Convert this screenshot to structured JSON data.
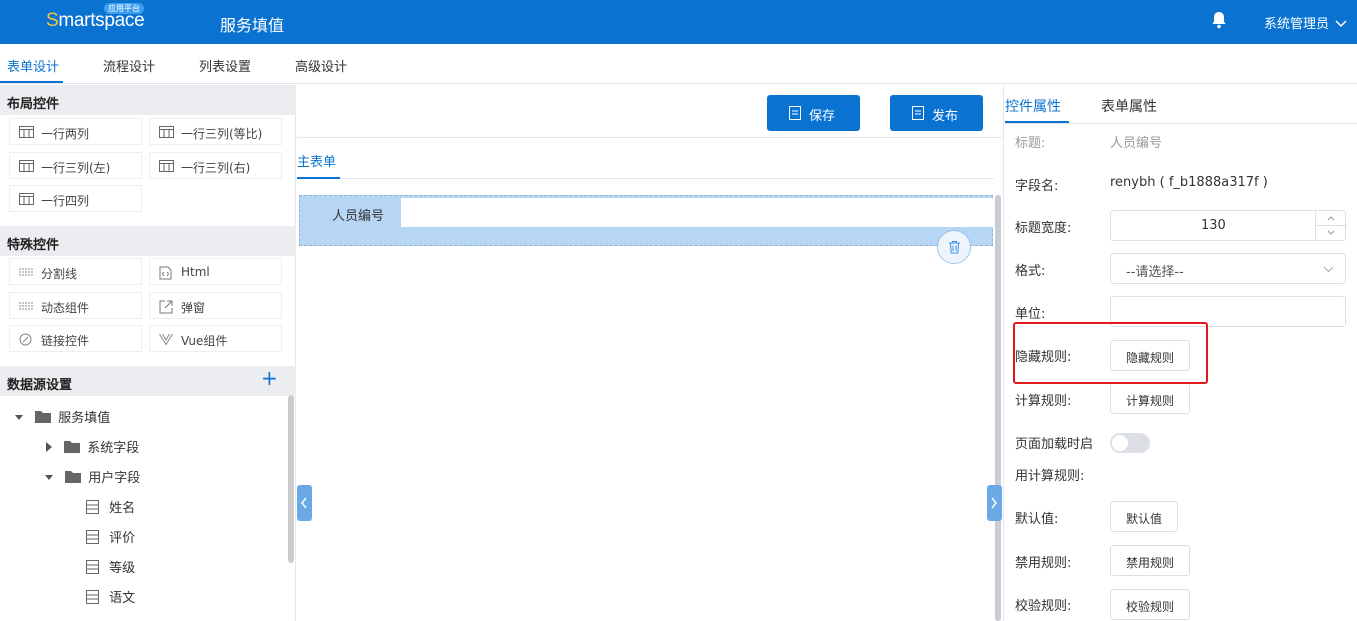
{
  "header": {
    "logo_text": "martspace",
    "logo_s": "S",
    "logo_badge": "应用平台",
    "app_title": "服务填值",
    "user_label": "系统管理员"
  },
  "tabs": [
    {
      "label": "表单设计",
      "active": true
    },
    {
      "label": "流程设计"
    },
    {
      "label": "列表设置"
    },
    {
      "label": "高级设计"
    }
  ],
  "left_panel": {
    "layout_title": "布局控件",
    "layout_controls": [
      "一行两列",
      "一行三列(等比)",
      "一行三列(左)",
      "一行三列(右)",
      "一行四列"
    ],
    "special_title": "特殊控件",
    "special_controls": [
      "分割线",
      "Html",
      "动态组件",
      "弹窗",
      "链接控件",
      "Vue组件"
    ],
    "datasource_title": "数据源设置",
    "tree": {
      "root": "服务填值",
      "system_fields": "系统字段",
      "user_fields": "用户字段",
      "user_field_items": [
        "姓名",
        "评价",
        "等级",
        "语文"
      ]
    }
  },
  "center": {
    "save_label": "保存",
    "publish_label": "发布",
    "subtab": "主表单",
    "field_label": "人员编号"
  },
  "right_panel": {
    "tabs": [
      "控件属性",
      "表单属性"
    ],
    "title_label": "标题:",
    "title_value": "人员编号",
    "fieldname_label": "字段名:",
    "fieldname_value": "renybh ( f_b1888a317f )",
    "width_label": "标题宽度:",
    "width_value": "130",
    "format_label": "格式:",
    "format_placeholder": "--请选择--",
    "unit_label": "单位:",
    "hide_label": "隐藏规则:",
    "hide_btn": "隐藏规则",
    "calc_label": "计算规则:",
    "calc_btn": "计算规则",
    "onload_label_1": "页面加载时启",
    "onload_label_2": "用计算规则:",
    "default_label": "默认值:",
    "default_btn": "默认值",
    "disable_label": "禁用规则:",
    "disable_btn": "禁用规则",
    "validate_label": "校验规则:",
    "validate_btn": "校验规则"
  },
  "colors": {
    "primary": "#0a73d1",
    "highlight": "#e4171c",
    "field_bg": "#b7d5f5"
  }
}
